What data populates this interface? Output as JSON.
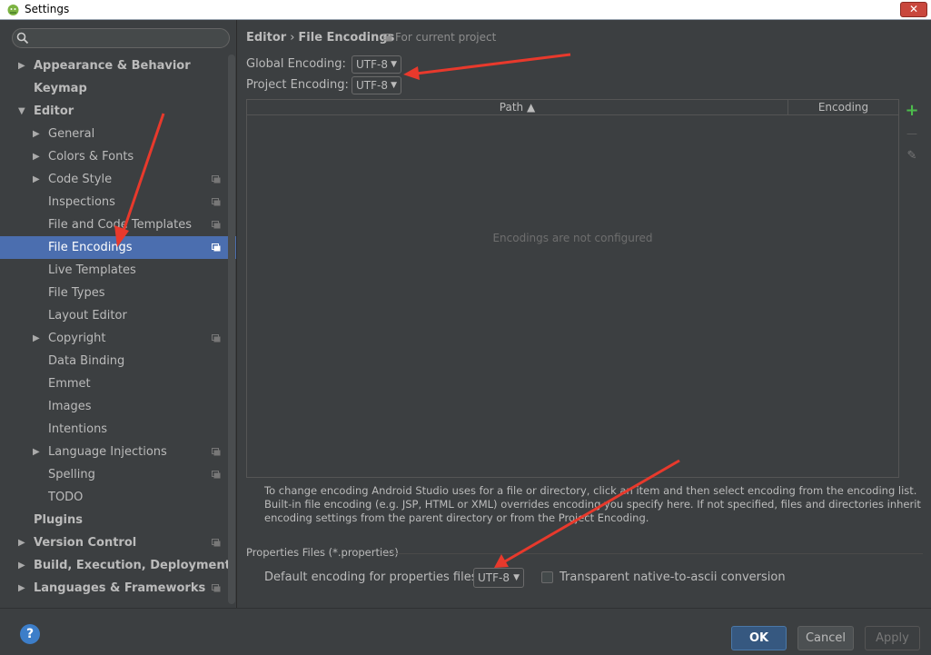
{
  "window": {
    "title": "Settings",
    "close_label": "✕"
  },
  "search": {
    "placeholder": ""
  },
  "sidebar": {
    "items": [
      {
        "label": "Appearance & Behavior",
        "level": 0,
        "arrow": "right",
        "bold": true,
        "proj": false
      },
      {
        "label": "Keymap",
        "level": 0,
        "arrow": "none",
        "bold": true,
        "proj": false
      },
      {
        "label": "Editor",
        "level": 0,
        "arrow": "down",
        "bold": true,
        "proj": false
      },
      {
        "label": "General",
        "level": 1,
        "arrow": "right",
        "bold": false,
        "proj": false
      },
      {
        "label": "Colors & Fonts",
        "level": 1,
        "arrow": "right",
        "bold": false,
        "proj": false
      },
      {
        "label": "Code Style",
        "level": 1,
        "arrow": "right",
        "bold": false,
        "proj": true
      },
      {
        "label": "Inspections",
        "level": 1,
        "arrow": "none",
        "bold": false,
        "proj": true
      },
      {
        "label": "File and Code Templates",
        "level": 1,
        "arrow": "none",
        "bold": false,
        "proj": true
      },
      {
        "label": "File Encodings",
        "level": 1,
        "arrow": "none",
        "bold": false,
        "proj": true,
        "selected": true
      },
      {
        "label": "Live Templates",
        "level": 1,
        "arrow": "none",
        "bold": false,
        "proj": false
      },
      {
        "label": "File Types",
        "level": 1,
        "arrow": "none",
        "bold": false,
        "proj": false
      },
      {
        "label": "Layout Editor",
        "level": 1,
        "arrow": "none",
        "bold": false,
        "proj": false
      },
      {
        "label": "Copyright",
        "level": 1,
        "arrow": "right",
        "bold": false,
        "proj": true
      },
      {
        "label": "Data Binding",
        "level": 1,
        "arrow": "none",
        "bold": false,
        "proj": false
      },
      {
        "label": "Emmet",
        "level": 1,
        "arrow": "none",
        "bold": false,
        "proj": false
      },
      {
        "label": "Images",
        "level": 1,
        "arrow": "none",
        "bold": false,
        "proj": false
      },
      {
        "label": "Intentions",
        "level": 1,
        "arrow": "none",
        "bold": false,
        "proj": false
      },
      {
        "label": "Language Injections",
        "level": 1,
        "arrow": "right",
        "bold": false,
        "proj": true
      },
      {
        "label": "Spelling",
        "level": 1,
        "arrow": "none",
        "bold": false,
        "proj": true
      },
      {
        "label": "TODO",
        "level": 1,
        "arrow": "none",
        "bold": false,
        "proj": false
      },
      {
        "label": "Plugins",
        "level": 0,
        "arrow": "none",
        "bold": true,
        "proj": false
      },
      {
        "label": "Version Control",
        "level": 0,
        "arrow": "right",
        "bold": true,
        "proj": true
      },
      {
        "label": "Build, Execution, Deployment",
        "level": 0,
        "arrow": "right",
        "bold": true,
        "proj": false
      },
      {
        "label": "Languages & Frameworks",
        "level": 0,
        "arrow": "right",
        "bold": true,
        "proj": true
      }
    ]
  },
  "main": {
    "breadcrumb": {
      "parent": "Editor",
      "sep": "›",
      "current": "File Encodings"
    },
    "scope": "For current project",
    "global_encoding": {
      "label": "Global Encoding:",
      "value": "UTF-8"
    },
    "project_encoding": {
      "label": "Project Encoding:",
      "value": "UTF-8"
    },
    "table": {
      "columns": [
        "Path ▲",
        "Encoding"
      ],
      "empty_text": "Encodings are not configured"
    },
    "tools": {
      "add": "+",
      "remove": "—",
      "edit": "✎"
    },
    "hint": "To change encoding Android Studio uses for a file or directory, click an item and then select encoding from the encoding list. Built-in file encoding (e.g. JSP, HTML or XML) overrides encoding you specify here. If not specified, files and directories inherit encoding settings from the parent directory or from the Project Encoding.",
    "properties": {
      "group_title": "Properties Files (*.properties)",
      "default_label": "Default encoding for properties files:",
      "default_value": "UTF-8",
      "transparent_label": "Transparent native-to-ascii conversion",
      "transparent_checked": false
    }
  },
  "footer": {
    "help": "?",
    "ok": "OK",
    "cancel": "Cancel",
    "apply": "Apply"
  },
  "colors": {
    "accent": "#4b6eaf",
    "arrow": "#e8392c",
    "background": "#3c3f41"
  }
}
